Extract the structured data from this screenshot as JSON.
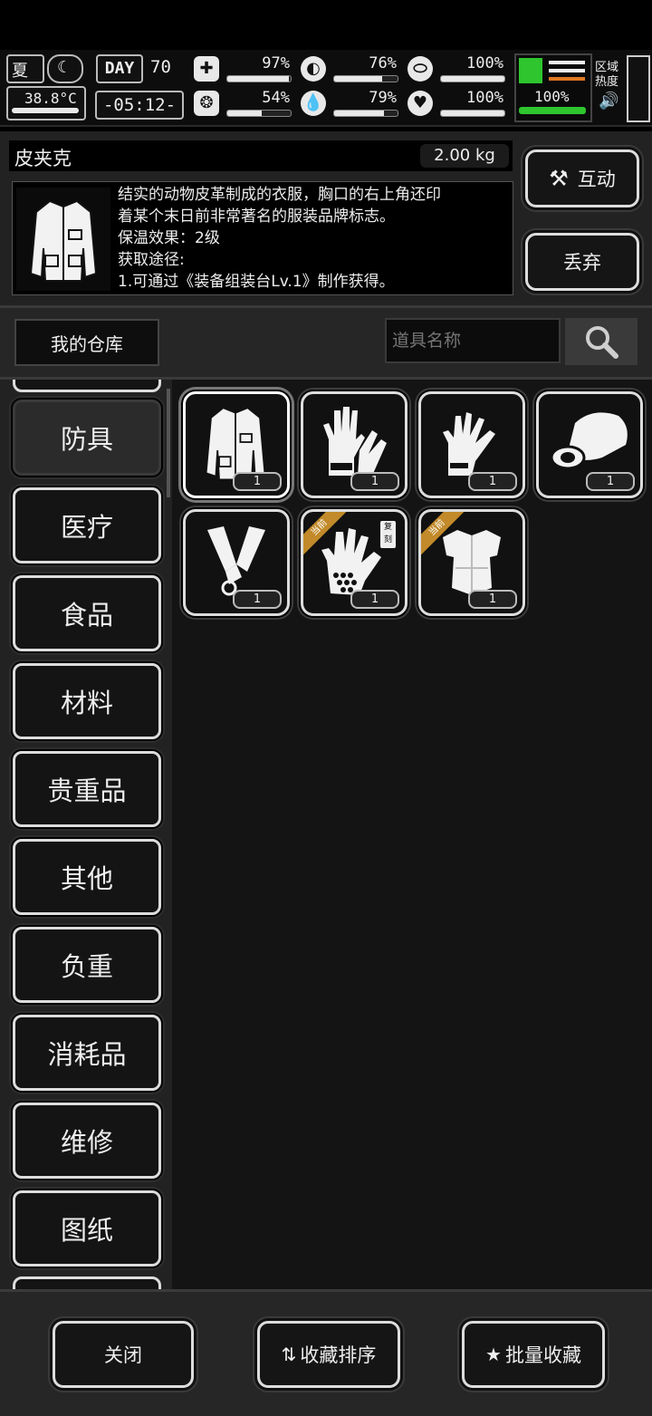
{
  "status": {
    "season": "夏",
    "temperature": "38.8°C",
    "day_label": "DAY",
    "day_number": "70",
    "clock": "-05:12-",
    "stats": [
      {
        "icon": "medkit-icon",
        "value": "97%",
        "level": 0.97
      },
      {
        "icon": "stomach-icon",
        "value": "76%",
        "level": 0.76
      },
      {
        "icon": "pill-icon",
        "value": "100%",
        "level": 1.0
      },
      {
        "icon": "brain-icon",
        "value": "54%",
        "level": 0.54
      },
      {
        "icon": "water-drop-icon",
        "value": "79%",
        "level": 0.79
      },
      {
        "icon": "heart-icon",
        "value": "100%",
        "level": 1.0
      }
    ],
    "stamina": "100%",
    "zone_heat_label": "区域热度"
  },
  "item": {
    "name": "皮夹克",
    "weight": "2.00 kg",
    "description_lines": [
      "结实的动物皮革制成的衣服，胸口的右上角还印",
      "着某个末日前非常著名的服装品牌标志。",
      "保温效果：2级",
      "获取途径:",
      "1.可通过《装备组装台Lv.1》制作获得。"
    ]
  },
  "actions": {
    "interact_label": "互动",
    "discard_label": "丢弃"
  },
  "warehouse": {
    "title": "我的仓库",
    "search_placeholder": "道具名称"
  },
  "categories": [
    "防具",
    "医疗",
    "食品",
    "材料",
    "贵重品",
    "其他",
    "负重",
    "消耗品",
    "维修",
    "图纸"
  ],
  "inventory": [
    {
      "icon": "leather-jacket-icon",
      "count": "1"
    },
    {
      "icon": "gloves-icon",
      "count": "1"
    },
    {
      "icon": "glove-icon",
      "count": "1"
    },
    {
      "icon": "helmet-icon",
      "count": "1"
    },
    {
      "icon": "arm-guards-icon",
      "count": "1"
    },
    {
      "icon": "scale-gloves-icon",
      "count": "1",
      "ribbon": "当前",
      "tag": "复刻"
    },
    {
      "icon": "body-armor-icon",
      "count": "1",
      "ribbon": "当前"
    }
  ],
  "footer": {
    "close_label": "关闭",
    "sort_label": "收藏排序",
    "batch_label": "批量收藏"
  }
}
